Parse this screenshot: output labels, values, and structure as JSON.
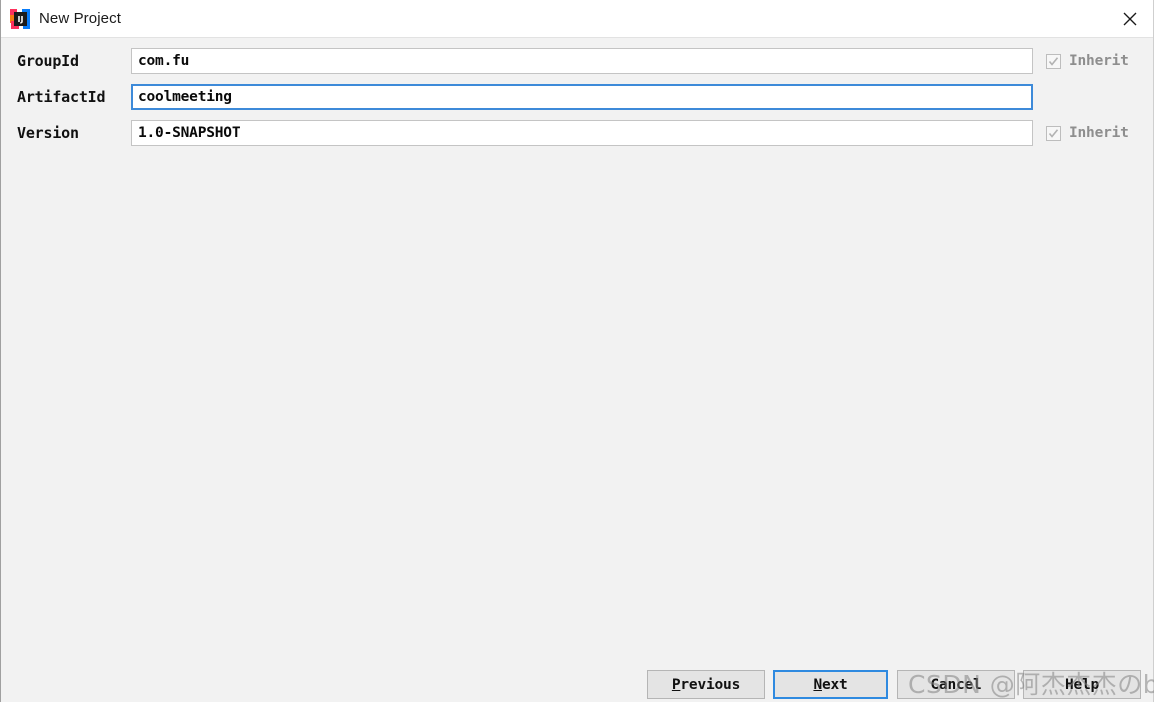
{
  "window": {
    "title": "New Project",
    "app_icon": "intellij-idea-logo-icon",
    "close_icon": "close-icon"
  },
  "form": {
    "rows": [
      {
        "label": "GroupId",
        "value": "com.fu",
        "placeholder": "",
        "focused": false,
        "inherit": {
          "label": "Inherit",
          "checked": true,
          "enabled": false
        }
      },
      {
        "label": "ArtifactId",
        "value": "coolmeeting",
        "placeholder": "",
        "focused": true,
        "inherit": null
      },
      {
        "label": "Version",
        "value": "1.0-SNAPSHOT",
        "placeholder": "",
        "focused": false,
        "inherit": {
          "label": "Inherit",
          "checked": true,
          "enabled": false
        }
      }
    ]
  },
  "footer": {
    "previous": {
      "label": "Previous",
      "mnemonic": "P",
      "rest": "revious"
    },
    "next": {
      "label": "Next",
      "mnemonic": "N",
      "rest": "ext"
    },
    "cancel": {
      "label": "Cancel"
    },
    "help": {
      "label": "Help"
    }
  },
  "watermark": {
    "text": "CSDN @阿杰杰杰のblog"
  },
  "colors": {
    "accent_focus": "#3d8ad9",
    "button_focus": "#2f8ae0",
    "window_bg": "#f2f2f2",
    "titlebar_bg": "#ffffff",
    "field_bg": "#ffffff",
    "disabled_text": "#8e8e8e"
  }
}
